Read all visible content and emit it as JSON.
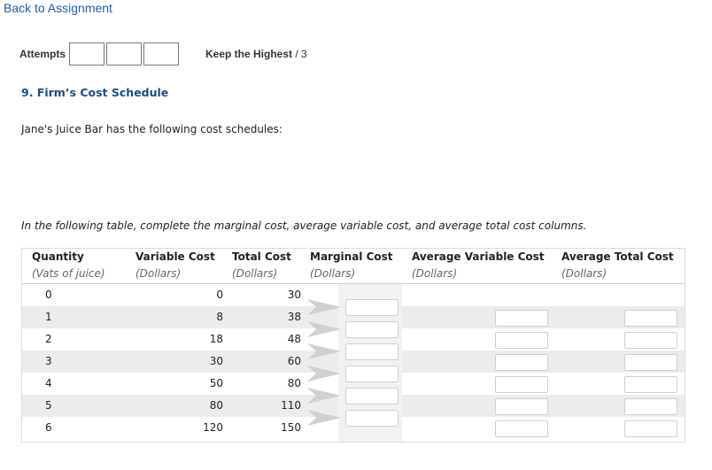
{
  "nav": {
    "back_label": "Back to Assignment"
  },
  "attempts": {
    "label": "Attempts",
    "boxes": 3,
    "keep_label": "Keep the Highest",
    "keep_suffix": "/ 3"
  },
  "question": {
    "title": "9. Firm’s Cost Schedule",
    "intro": "Jane's Juice Bar has the following cost schedules:",
    "instruction": "In the following table, complete the marginal cost, average variable cost, and average total cost columns."
  },
  "table": {
    "headers": [
      {
        "title": "Quantity",
        "unit": "(Vats of juice)"
      },
      {
        "title": "Variable Cost",
        "unit": "(Dollars)"
      },
      {
        "title": "Total Cost",
        "unit": "(Dollars)"
      },
      {
        "title": "Marginal Cost",
        "unit": "(Dollars)"
      },
      {
        "title": "Average Variable Cost",
        "unit": "(Dollars)"
      },
      {
        "title": "Average Total Cost",
        "unit": "(Dollars)"
      }
    ],
    "rows": [
      {
        "quantity": "0",
        "variable_cost": "0",
        "total_cost": "30"
      },
      {
        "quantity": "1",
        "variable_cost": "8",
        "total_cost": "38"
      },
      {
        "quantity": "2",
        "variable_cost": "18",
        "total_cost": "48"
      },
      {
        "quantity": "3",
        "variable_cost": "30",
        "total_cost": "60"
      },
      {
        "quantity": "4",
        "variable_cost": "50",
        "total_cost": "80"
      },
      {
        "quantity": "5",
        "variable_cost": "80",
        "total_cost": "110"
      },
      {
        "quantity": "6",
        "variable_cost": "120",
        "total_cost": "150"
      }
    ]
  },
  "colors": {
    "link": "#1f5fa8",
    "title": "#1b4d80",
    "row_shade": "#ececec",
    "arrow": "#d0d0d0"
  }
}
